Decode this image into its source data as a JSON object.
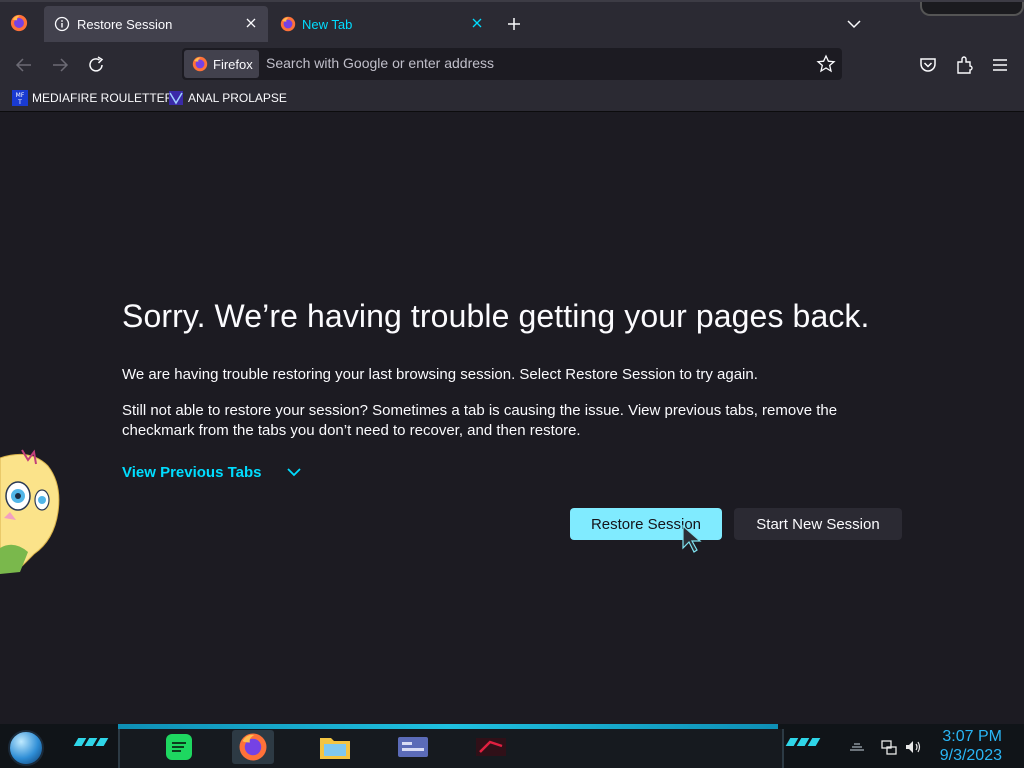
{
  "browser": {
    "tabs": [
      {
        "label": "Restore Session",
        "icon": "info-icon",
        "active": true
      },
      {
        "label": "New Tab",
        "icon": "firefox-icon",
        "active": false
      }
    ],
    "identity_label": "Firefox",
    "address_placeholder": "Search with Google or enter address"
  },
  "bookmarks": [
    {
      "label": "MEDIAFIRE ROULETTER",
      "icon": "mediafire-bookmark-icon"
    },
    {
      "label": "ANAL PROLAPSE",
      "icon": "bookmark-favicon"
    }
  ],
  "page": {
    "title": "Sorry. We’re having trouble getting your pages back.",
    "paragraph1": "We are having trouble restoring your last browsing session. Select Restore Session to try again.",
    "paragraph2": "Still not able to restore your session? Sometimes a tab is causing the issue. View previous tabs, remove the checkmark from the tabs you don’t need to recover, and then restore.",
    "view_previous_tabs": "View Previous Tabs",
    "restore_button": "Restore Session",
    "new_session_button": "Start New Session"
  },
  "taskbar": {
    "apps": [
      "spotify-icon",
      "firefox-icon",
      "file-explorer-icon",
      "id-card-app-icon",
      "game-app-icon"
    ],
    "time": "3:07 PM",
    "date": "9/3/2023"
  },
  "colors": {
    "accent": "#00ddff",
    "primary_button": "#80ebff",
    "background": "#1c1b22",
    "toolbar": "#2b2a33"
  }
}
